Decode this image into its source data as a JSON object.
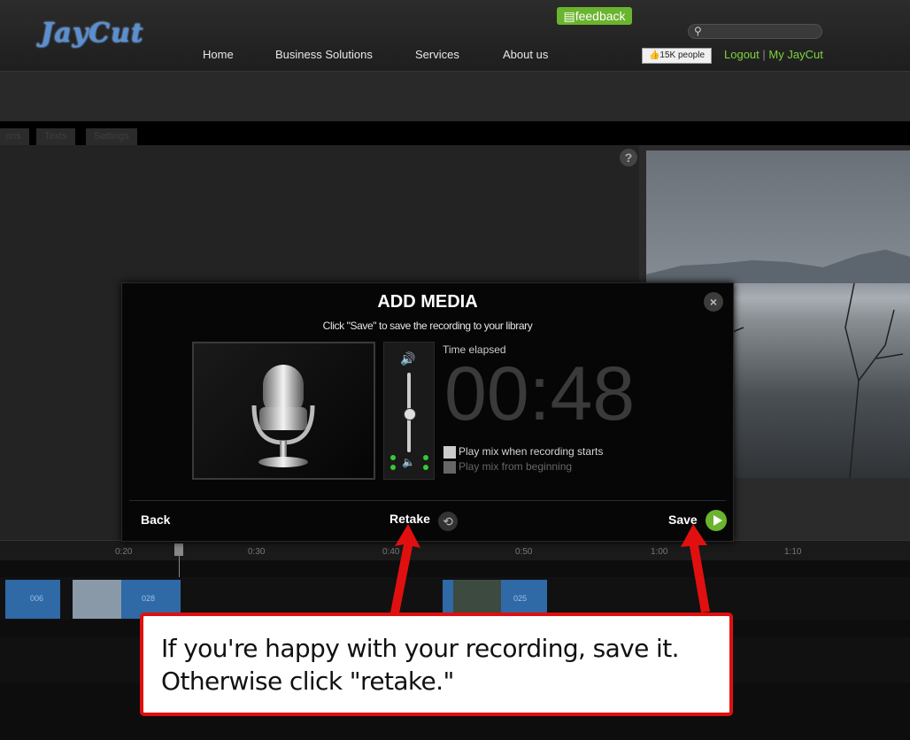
{
  "header": {
    "logo": "JayCut",
    "nav": [
      {
        "label": "Home"
      },
      {
        "label": "Business Solutions"
      },
      {
        "label": "Services"
      },
      {
        "label": "About us"
      }
    ],
    "feedback_label": "feedback",
    "search_placeholder": "",
    "like_label": "15K people",
    "logout_label": "Logout",
    "separator": "|",
    "myjaycut_label": "My JayCut"
  },
  "tabs": [
    {
      "label": "ons"
    },
    {
      "label": "Texts"
    },
    {
      "label": "Settings"
    }
  ],
  "help_label": "?",
  "modal": {
    "title": "ADD MEDIA",
    "subtitle": "Click \"Save\" to save the recording to your library",
    "close_label": "×",
    "elapsed_label": "Time elapsed",
    "timer": "00:48",
    "option1": "Play mix when recording starts",
    "option2": "Play mix from beginning",
    "back_label": "Back",
    "retake_label": "Retake",
    "save_label": "Save"
  },
  "timeline": {
    "ticks": [
      "0:20",
      "0:30",
      "0:40",
      "0:50",
      "1:00",
      "1:10"
    ],
    "clips": [
      "006",
      "028",
      "025"
    ]
  },
  "annotation": {
    "text": "If you're happy with your recording, save it. Otherwise click \"retake.\""
  },
  "colors": {
    "accent_green": "#6ab42e",
    "link_green": "#7ed33a",
    "annotation_red": "#e01010",
    "clip_blue": "#2f69a6"
  }
}
